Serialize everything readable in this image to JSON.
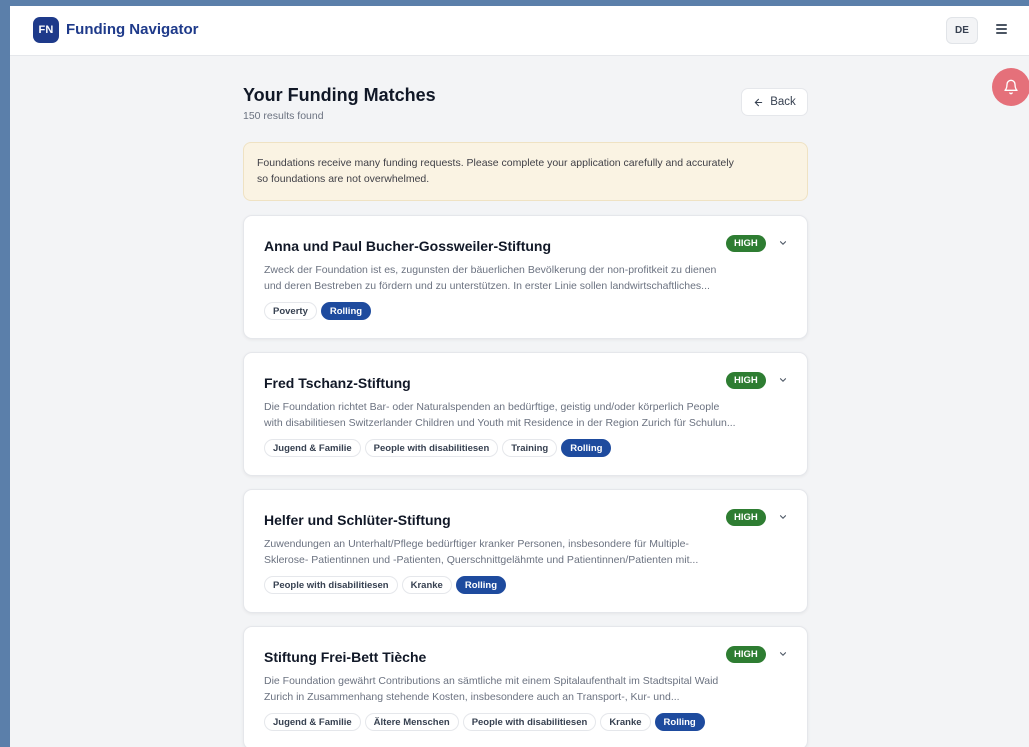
{
  "header": {
    "logo": "FN",
    "title": "Funding Navigator",
    "language": "DE"
  },
  "page": {
    "title": "Your Funding Matches",
    "results": "150 results found",
    "back_label": "Back"
  },
  "notice": {
    "line1": "Foundations receive many funding requests. Please complete your application carefully and accurately",
    "line2": "so foundations are not overwhelmed."
  },
  "colors": {
    "brand": "#1e3a8a",
    "high_badge": "#2e7d32",
    "rolling_tag": "#1e4b9e",
    "notice_bg": "#faf3e3",
    "bell": "#e5707a"
  },
  "cards": [
    {
      "title": "Anna und Paul Bucher-Gossweiler-Stiftung",
      "match": "HIGH",
      "desc1": "Zweck der Foundation ist es, zugunsten der bäuerlichen Bevölkerung der non-profitkeit zu dienen",
      "desc2": "und deren Bestreben zu fördern und zu unterstützen. In erster Linie sollen landwirtschaftliches...",
      "tags": [
        "Poverty"
      ],
      "status": "Rolling"
    },
    {
      "title": "Fred Tschanz-Stiftung",
      "match": "HIGH",
      "desc1": "Die Foundation richtet Bar- oder Naturalspenden an bedürftige, geistig und/oder körperlich People",
      "desc2": "with disabilitiesen Switzerlander Children und Youth mit Residence in der Region Zurich für Schulun...",
      "tags": [
        "Jugend & Familie",
        "People with disabilitiesen",
        "Training"
      ],
      "status": "Rolling"
    },
    {
      "title": "Helfer und Schlüter-Stiftung",
      "match": "HIGH",
      "desc1": "Zuwendungen an Unterhalt/Pflege bedürftiger kranker Personen, insbesondere für Multiple-",
      "desc2": "Sklerose- Patientinnen und -Patienten, Querschnittgelähmte und Patientinnen/Patienten mit...",
      "tags": [
        "People with disabilitiesen",
        "Kranke"
      ],
      "status": "Rolling"
    },
    {
      "title": "Stiftung Frei-Bett Tièche",
      "match": "HIGH",
      "desc1": "Die Foundation gewährt Contributions an sämtliche mit einem Spitalaufenthalt im Stadtspital Waid",
      "desc2": "Zurich in Zusammenhang stehende Kosten, insbesondere auch an Transport-, Kur- und...",
      "tags": [
        "Jugend & Familie",
        "Ältere Menschen",
        "People with disabilitiesen",
        "Kranke"
      ],
      "status": "Rolling"
    }
  ]
}
